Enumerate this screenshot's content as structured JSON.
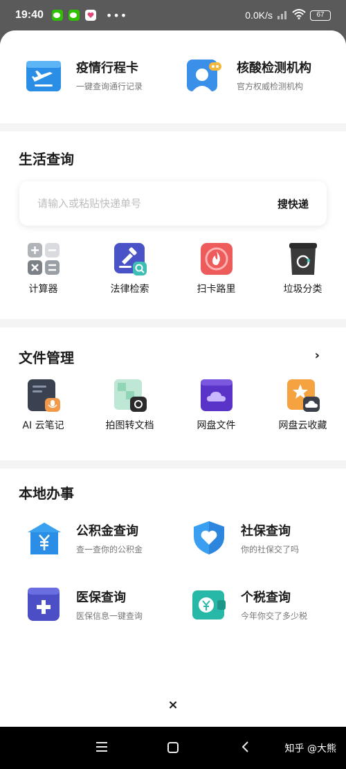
{
  "status_bar": {
    "time": "19:40",
    "network_speed": "0.0K/s",
    "battery": "67"
  },
  "top_cards": [
    {
      "title": "疫情行程卡",
      "subtitle": "一键查询通行记录",
      "icon": "plane-card-icon"
    },
    {
      "title": "核酸检测机构",
      "subtitle": "官方权威检测机构",
      "icon": "doctor-icon"
    }
  ],
  "life_query": {
    "title": "生活查询",
    "search_placeholder": "请输入或粘贴快递单号",
    "search_button": "搜快递",
    "items": [
      {
        "label": "计算器",
        "icon": "calculator-icon"
      },
      {
        "label": "法律检索",
        "icon": "gavel-icon"
      },
      {
        "label": "扫卡路里",
        "icon": "flame-icon"
      },
      {
        "label": "垃圾分类",
        "icon": "trash-bin-icon"
      }
    ]
  },
  "file_management": {
    "title": "文件管理",
    "items": [
      {
        "label": "AI 云笔记",
        "icon": "note-icon"
      },
      {
        "label": "拍图转文档",
        "icon": "scan-doc-icon"
      },
      {
        "label": "网盘文件",
        "icon": "cloud-drive-icon"
      },
      {
        "label": "网盘云收藏",
        "icon": "cloud-favorite-icon"
      }
    ]
  },
  "local_affairs": {
    "title": "本地办事",
    "items": [
      {
        "title": "公积金查询",
        "subtitle": "查一查你的公积金",
        "icon": "fund-house-icon"
      },
      {
        "title": "社保查询",
        "subtitle": "你的社保交了吗",
        "icon": "shield-heart-icon"
      },
      {
        "title": "医保查询",
        "subtitle": "医保信息一键查询",
        "icon": "medical-kit-icon"
      },
      {
        "title": "个税查询",
        "subtitle": "今年你交了多少税",
        "icon": "tax-wallet-icon"
      }
    ]
  },
  "close_label": "×",
  "watermark": "知乎 @大熊"
}
